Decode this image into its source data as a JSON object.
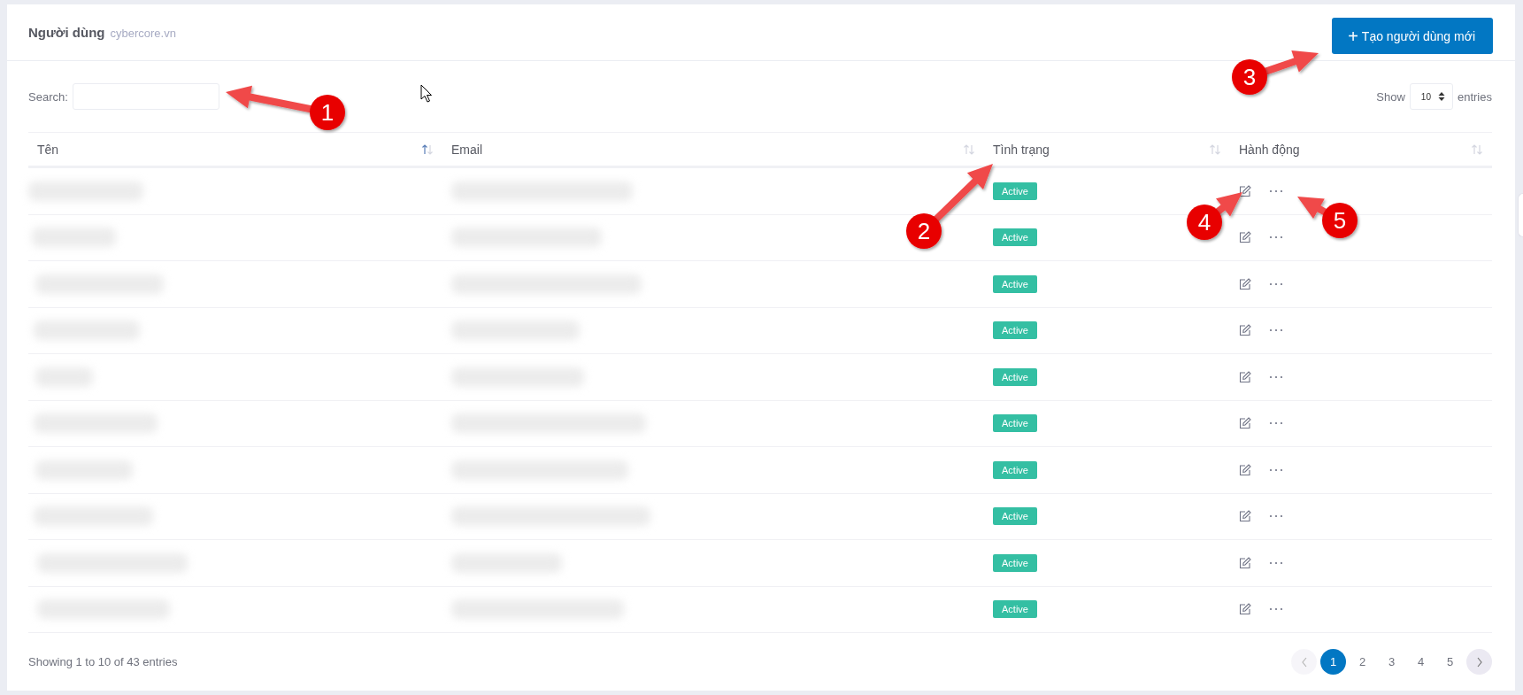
{
  "header": {
    "title": "Người dùng",
    "subtitle": "cybercore.vn",
    "create_button": {
      "icon": "+",
      "label": "Tạo người dùng mới"
    }
  },
  "search": {
    "label": "Search:"
  },
  "length": {
    "show": "Show",
    "value": "10",
    "entries": "entries"
  },
  "table": {
    "columns": [
      {
        "label": "Tên",
        "sorted": true
      },
      {
        "label": "Email",
        "sorted": false
      },
      {
        "label": "Tình trạng",
        "sorted": false
      },
      {
        "label": "Hành động",
        "sorted": false
      }
    ],
    "rows": [
      {
        "status": "Active"
      },
      {
        "status": "Active"
      },
      {
        "status": "Active"
      },
      {
        "status": "Active"
      },
      {
        "status": "Active"
      },
      {
        "status": "Active"
      },
      {
        "status": "Active"
      },
      {
        "status": "Active"
      },
      {
        "status": "Active"
      },
      {
        "status": "Active"
      }
    ]
  },
  "footer": {
    "info": "Showing 1 to 10 of 43 entries"
  },
  "pagination": {
    "prev_disabled": true,
    "next_disabled": false,
    "pages": [
      {
        "label": "1",
        "selected": true
      },
      {
        "label": "2",
        "selected": false
      },
      {
        "label": "3",
        "selected": false
      },
      {
        "label": "4",
        "selected": false
      },
      {
        "label": "5",
        "selected": false
      }
    ]
  },
  "annotations": [
    {
      "number": "1"
    },
    {
      "number": "2"
    },
    {
      "number": "3"
    },
    {
      "number": "4"
    },
    {
      "number": "5"
    }
  ]
}
